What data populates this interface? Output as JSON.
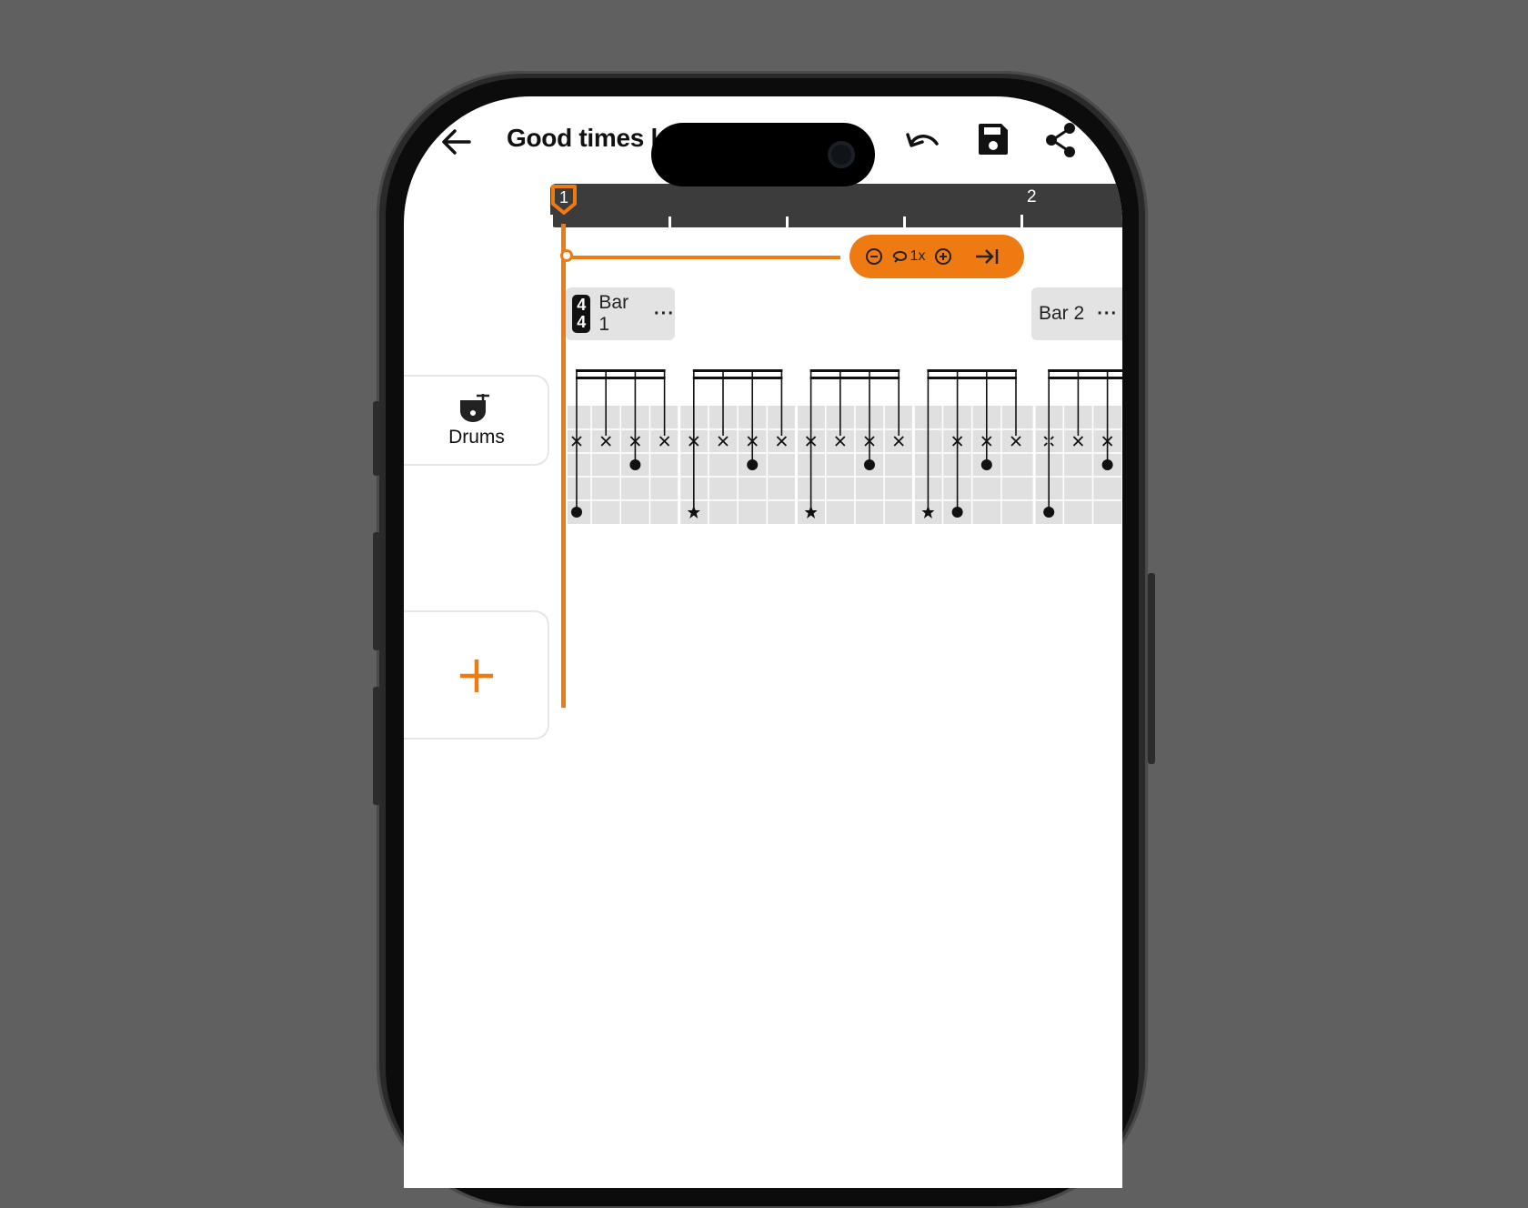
{
  "header": {
    "title": "Good times l",
    "back_icon": "arrow-left-icon",
    "undo_icon": "undo-icon",
    "save_icon": "floppy-disk-icon",
    "share_icon": "share-icon"
  },
  "timeline": {
    "markers": [
      "1",
      "2"
    ]
  },
  "loop_controls": {
    "zoom_out_icon": "circle-minus-icon",
    "loop_icon": "loop-icon",
    "loop_count": "1x",
    "zoom_in_icon": "circle-plus-icon",
    "skip_end_icon": "skip-to-end-icon"
  },
  "bars": [
    {
      "name": "Bar 1",
      "time_signature": {
        "top": "4",
        "bottom": "4"
      },
      "more": "···"
    },
    {
      "name": "Bar 2",
      "more": "···"
    }
  ],
  "tracks": [
    {
      "name": "Drums",
      "icon": "drum-icon"
    }
  ],
  "add_track": {
    "icon": "plus-icon"
  },
  "colors": {
    "accent": "#f07a12",
    "ruler_bg": "#3c3c3c",
    "grid_bg": "#e0e0e0",
    "background": "#606060"
  },
  "pattern": {
    "steps": [
      {
        "hihat": "x",
        "snare": false,
        "kick": "dot"
      },
      {
        "hihat": "x",
        "snare": false,
        "kick": null
      },
      {
        "hihat": "x",
        "snare": true,
        "kick": null
      },
      {
        "hihat": "x",
        "snare": false,
        "kick": null
      },
      {
        "hihat": "x",
        "snare": false,
        "kick": "star"
      },
      {
        "hihat": "x",
        "snare": false,
        "kick": null
      },
      {
        "hihat": "x",
        "snare": true,
        "kick": null
      },
      {
        "hihat": "x",
        "snare": false,
        "kick": null
      },
      {
        "hihat": "x",
        "snare": false,
        "kick": "star"
      },
      {
        "hihat": "x",
        "snare": false,
        "kick": null
      },
      {
        "hihat": "x",
        "snare": true,
        "kick": null
      },
      {
        "hihat": "x",
        "snare": false,
        "kick": null
      },
      {
        "hihat": null,
        "snare": false,
        "kick": "star"
      },
      {
        "hihat": "x",
        "snare": false,
        "kick": "dot"
      },
      {
        "hihat": "x",
        "snare": true,
        "kick": null
      },
      {
        "hihat": "x",
        "snare": false,
        "kick": null
      },
      {
        "hihat": "open",
        "snare": false,
        "kick": "dot"
      },
      {
        "hihat": "x",
        "snare": false,
        "kick": null
      },
      {
        "hihat": "x",
        "snare": true,
        "kick": null
      },
      {
        "hihat": null,
        "snare": false,
        "kick": null
      }
    ]
  }
}
